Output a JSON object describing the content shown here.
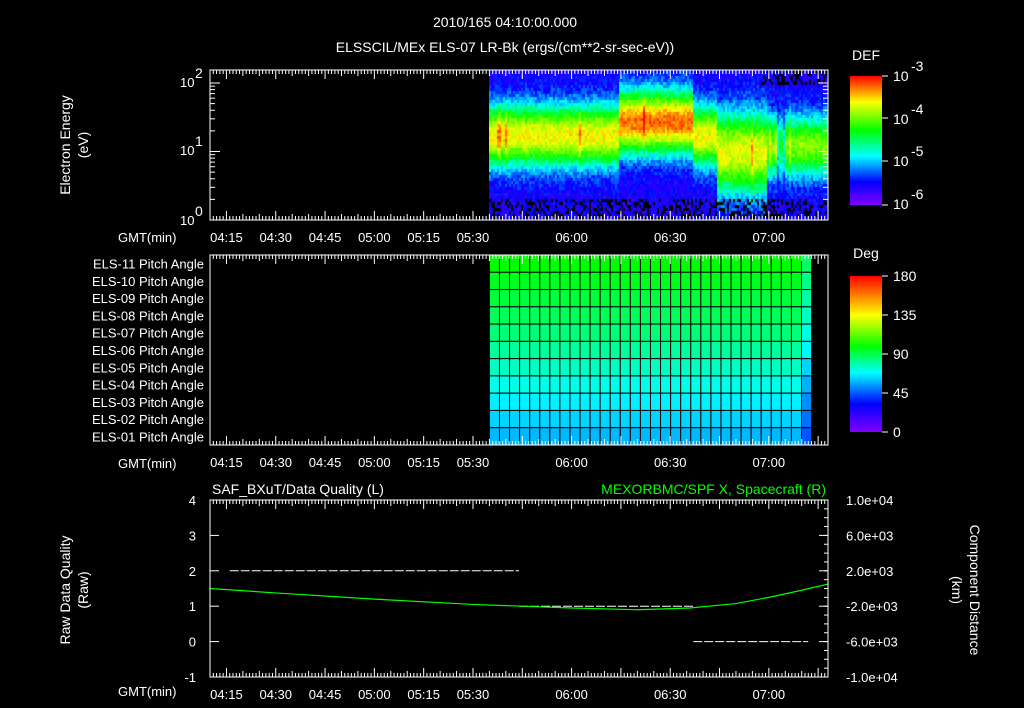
{
  "header": {
    "datetime": "2010/165 04:10:00.000",
    "title": "ELSSCIL/MEx ELS-07 LR-Bk  (ergs/(cm**2-sr-sec-eV))"
  },
  "colors": {
    "background": "#000000",
    "axis": "#ffffff",
    "right_series": "#00ff00"
  },
  "chart_data": [
    {
      "type": "heatmap",
      "title": "ELSSCIL/MEx ELS-07 LR-Bk  (ergs/(cm**2-sr-sec-eV))",
      "ylabel": [
        "Electron Energy",
        "(eV)"
      ],
      "xlabel": "GMT(min)",
      "yscale": "log",
      "ylim": [
        1,
        160
      ],
      "yticks": [
        "10",
        "10",
        "10"
      ],
      "ytick_exponents": [
        "0",
        "1",
        "2"
      ],
      "xlim": [
        "04:10",
        "07:18"
      ],
      "xticks": [
        "04:15",
        "04:30",
        "04:45",
        "05:00",
        "05:15",
        "05:30",
        "06:00",
        "06:30",
        "07:00"
      ],
      "data_start": "05:35",
      "colorbar": {
        "label": "DEF",
        "scale": "log",
        "range": [
          1e-06,
          0.001
        ],
        "ticks": [
          "10",
          "10",
          "10",
          "10"
        ],
        "tick_exponents": [
          "-3",
          "-4",
          "-5",
          "-6"
        ]
      }
    },
    {
      "type": "heatmap",
      "xlabel": "GMT(min)",
      "xlim": [
        "04:10",
        "07:18"
      ],
      "xticks": [
        "04:15",
        "04:30",
        "04:45",
        "05:00",
        "05:15",
        "05:30",
        "06:00",
        "06:30",
        "07:00"
      ],
      "rows": [
        "ELS-11 Pitch Angle",
        "ELS-10 Pitch Angle",
        "ELS-09 Pitch Angle",
        "ELS-08 Pitch Angle",
        "ELS-07 Pitch Angle",
        "ELS-06 Pitch Angle",
        "ELS-05 Pitch Angle",
        "ELS-04 Pitch Angle",
        "ELS-03 Pitch Angle",
        "ELS-02 Pitch Angle",
        "ELS-01 Pitch Angle"
      ],
      "row_values_deg": [
        104,
        100,
        96,
        92,
        88,
        83,
        78,
        73,
        68,
        64,
        60
      ],
      "data_range": [
        "05:35",
        "07:13"
      ],
      "colorbar": {
        "label": "Deg",
        "range": [
          0,
          180
        ],
        "ticks": [
          "180",
          "135",
          "90",
          "45",
          "0"
        ]
      }
    },
    {
      "type": "line",
      "left_title": "SAF_BXuT/Data Quality (L)",
      "right_title": "MEXORBMC/SPF X, Spacecraft (R)",
      "ylabel_left": [
        "Raw Data Quality",
        "(Raw)"
      ],
      "ylabel_right": [
        "Component Distance",
        "(km)"
      ],
      "xlabel": "GMT(min)",
      "ylim_left": [
        -1,
        4
      ],
      "yticks_left": [
        "4",
        "3",
        "2",
        "1",
        "0",
        "-1"
      ],
      "ylim_right": [
        -10000,
        10000
      ],
      "yticks_right": [
        "1.0e+04",
        "6.0e+03",
        "2.0e+03",
        "-2.0e+03",
        "-6.0e+03",
        "-1.0e+04"
      ],
      "xticks": [
        "04:15",
        "04:30",
        "04:45",
        "05:00",
        "05:15",
        "05:30",
        "06:00",
        "06:30",
        "07:00"
      ],
      "series": [
        {
          "name": "Data Quality",
          "axis": "left",
          "color": "#ffffff",
          "segments": [
            {
              "from": "04:16",
              "to": "05:44",
              "value": 2
            },
            {
              "from": "05:44",
              "to": "06:37",
              "value": 1
            },
            {
              "from": "06:37",
              "to": "07:12",
              "value": 0
            }
          ]
        },
        {
          "name": "SPF X",
          "axis": "right",
          "color": "#00ff00",
          "x": [
            "04:10",
            "04:30",
            "05:00",
            "05:30",
            "06:00",
            "06:20",
            "06:36",
            "06:50",
            "07:00",
            "07:10",
            "07:18"
          ],
          "y": [
            0,
            -500,
            -1200,
            -1800,
            -2200,
            -2400,
            -2200,
            -1700,
            -1000,
            -200,
            500
          ]
        }
      ]
    }
  ]
}
